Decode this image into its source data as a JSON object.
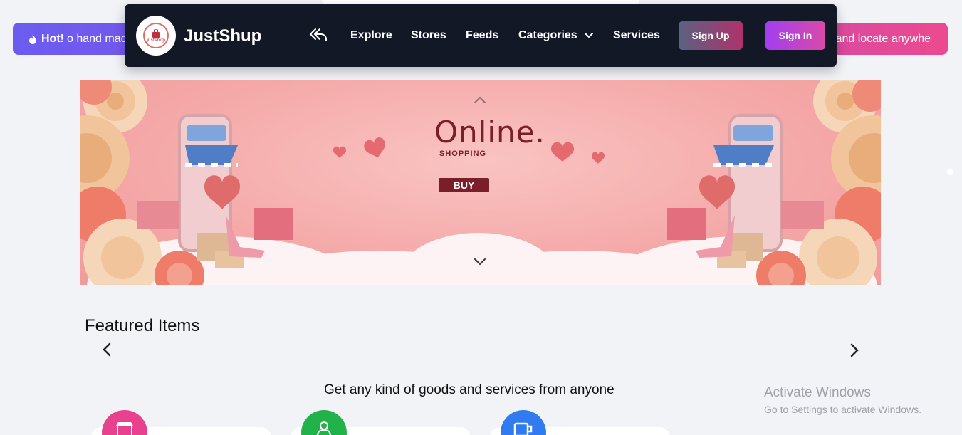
{
  "marquee": {
    "hot_label": "Hot!",
    "left_text": "o hand mac",
    "right_text": "and locate anywhe"
  },
  "nav": {
    "brand": "JustShup",
    "logo_text": "justshup",
    "items": [
      "Explore",
      "Stores",
      "Feeds",
      "Categories",
      "Services"
    ],
    "signup_label": "Sign Up",
    "signin_label": "Sign In"
  },
  "banner": {
    "title": "Online.",
    "subtitle": "SHOPPING",
    "buy_label": "BUY"
  },
  "featured": {
    "heading": "Featured Items"
  },
  "services": {
    "tagline": "Get any kind of goods and services from anyone",
    "icons": [
      "store-icon",
      "user-icon",
      "cup-icon"
    ],
    "colors": [
      "#e8418d",
      "#21b24a",
      "#2f7bef"
    ]
  },
  "watermark": {
    "title": "Activate Windows",
    "subtitle": "Go to Settings to activate Windows."
  },
  "colors": {
    "nav_bg": "#121826",
    "accent_pink": "#ec4a8f",
    "accent_purple": "#6b5cf0"
  }
}
